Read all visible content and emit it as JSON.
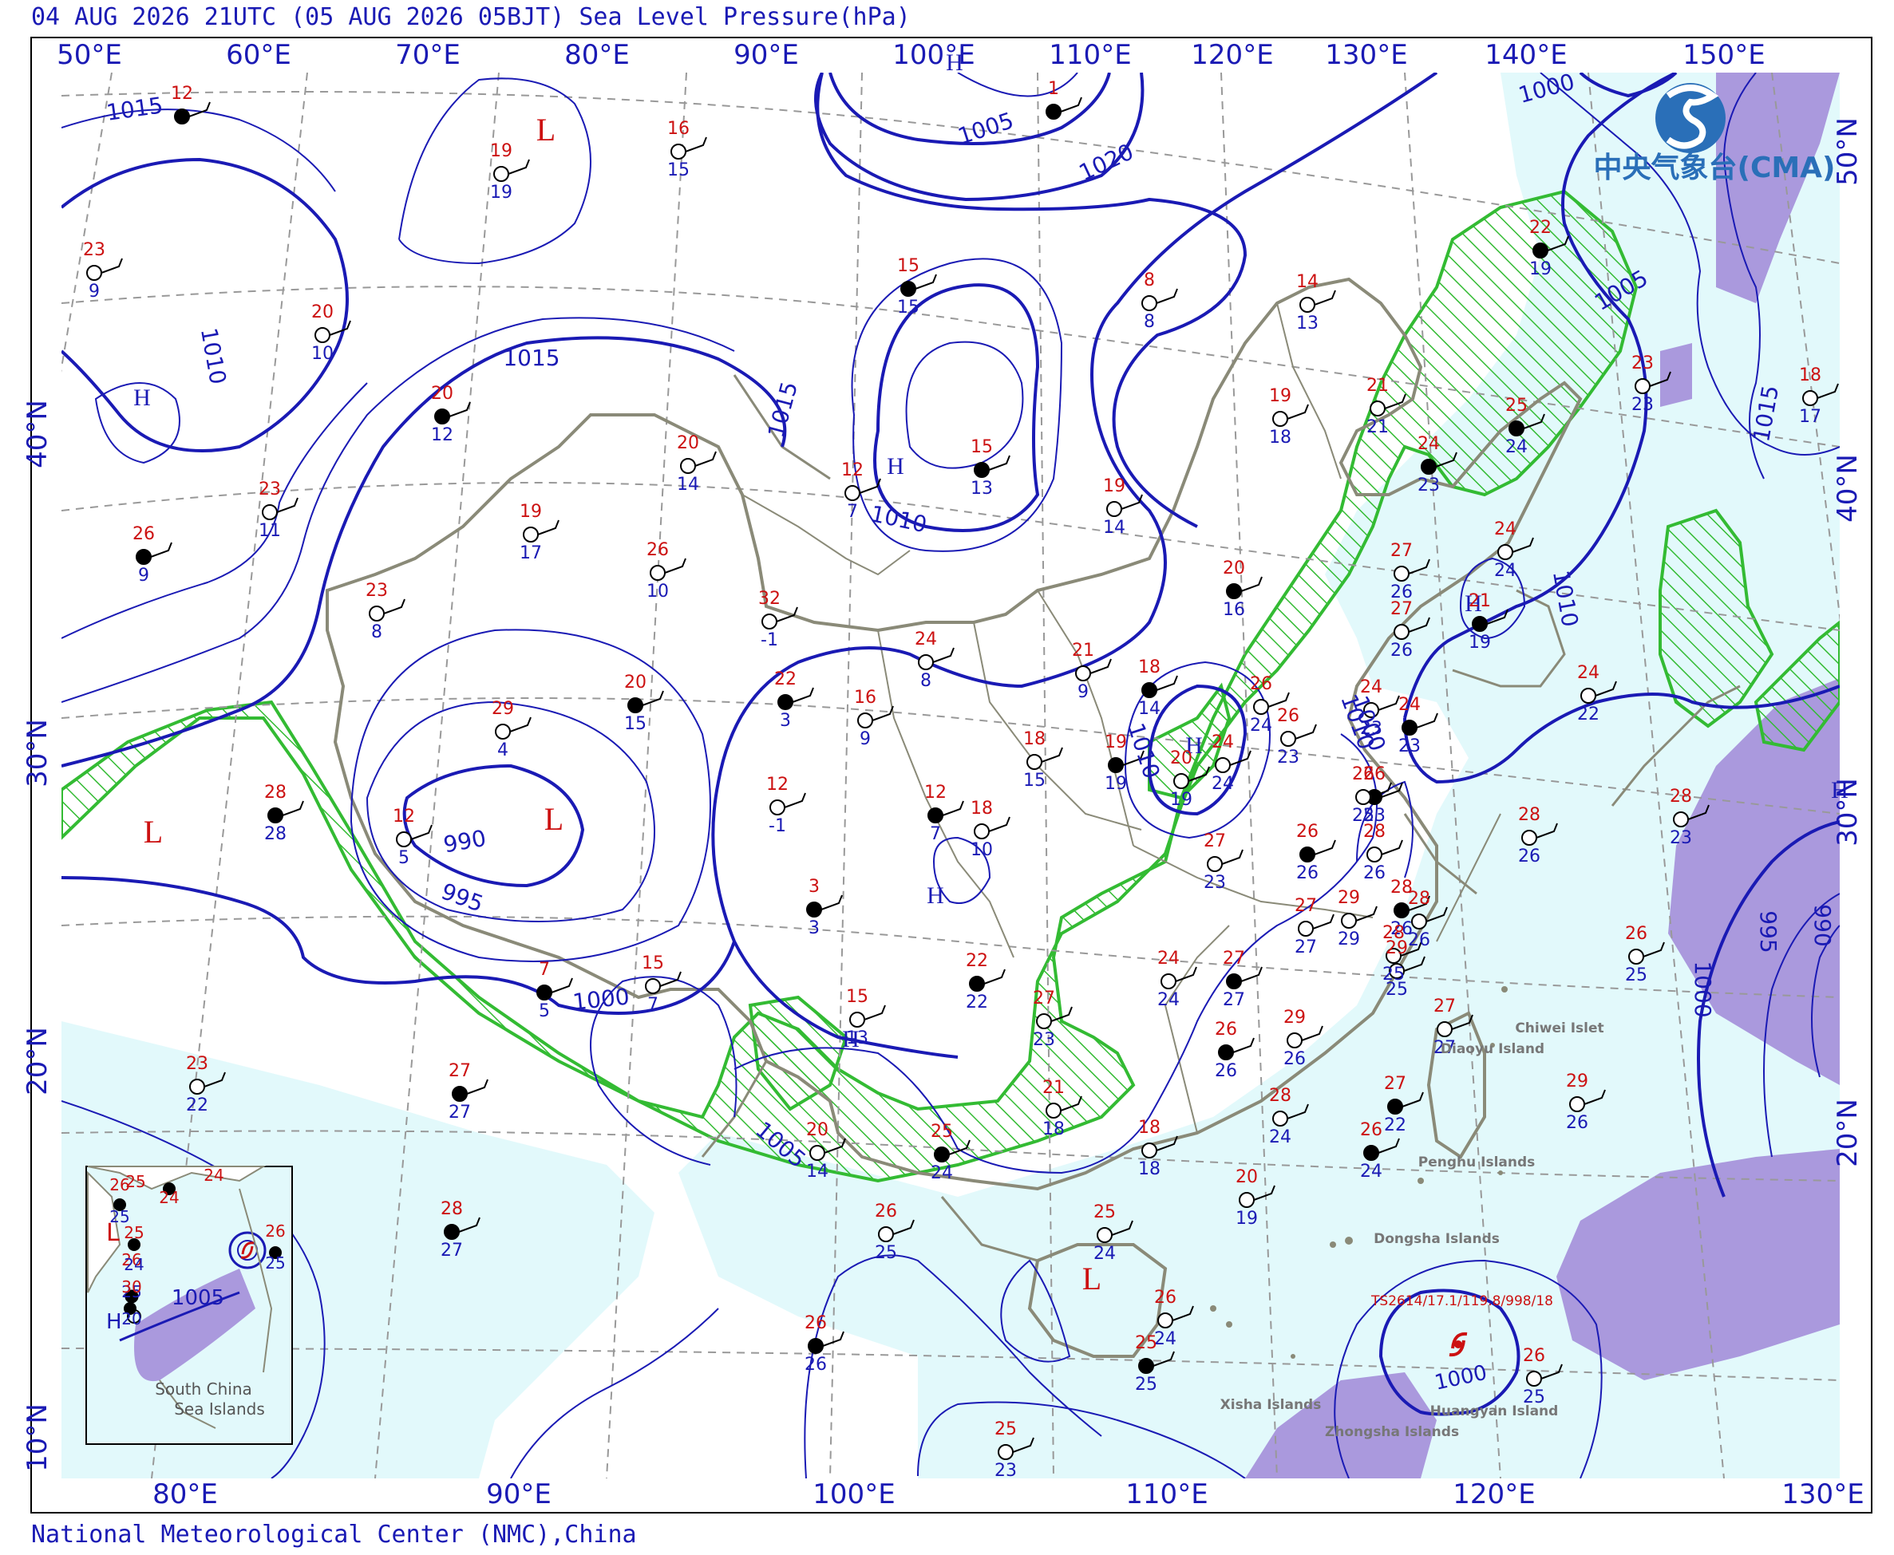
{
  "header": {
    "title": "04 AUG 2026 21UTC (05 AUG 2026 05BJT) Sea Level Pressure(hPa)"
  },
  "footer": {
    "credit": "National Meteorological Center (NMC),China"
  },
  "logo": {
    "text": "中央气象台(CMA)"
  },
  "axes": {
    "top_lon": [
      "50°E",
      "60°E",
      "70°E",
      "80°E",
      "90°E",
      "100°E",
      "110°E",
      "120°E",
      "130°E",
      "140°E",
      "150°E"
    ],
    "bottom_lon": [
      "80°E",
      "90°E",
      "100°E",
      "110°E",
      "120°E",
      "130°E"
    ],
    "left_lat": [
      "40°N",
      "30°N",
      "20°N",
      "10°N"
    ],
    "right_lat": [
      "50°N",
      "40°N",
      "30°N",
      "20°N"
    ]
  },
  "centers": [
    {
      "label": "L",
      "color": "#cc1111"
    },
    {
      "label": "L",
      "color": "#cc1111"
    },
    {
      "label": "L",
      "color": "#cc1111"
    },
    {
      "label": "L",
      "color": "#cc1111"
    },
    {
      "label": "H",
      "color": "#1a1ab4"
    },
    {
      "label": "H",
      "color": "#1a1ab4"
    },
    {
      "label": "H",
      "color": "#1a1ab4"
    },
    {
      "label": "H",
      "color": "#1a1ab4"
    },
    {
      "label": "H",
      "color": "#1a1ab4"
    },
    {
      "label": "H",
      "color": "#1a1ab4"
    },
    {
      "label": "H",
      "color": "#1a1ab4"
    },
    {
      "label": "H",
      "color": "#1a1ab4"
    }
  ],
  "isobar_labels": [
    "1015",
    "1010",
    "1005",
    "1020",
    "1015",
    "1010",
    "1015",
    "990",
    "995",
    "1000",
    "1005",
    "1010",
    "1010",
    "1005",
    "1010",
    "1015",
    "1000",
    "1000",
    "995",
    "990",
    "1000",
    "1005"
  ],
  "stations": [
    {
      "t": "12",
      "d": ""
    },
    {
      "t": "19",
      "d": "19"
    },
    {
      "t": "16",
      "d": "15"
    },
    {
      "t": "1",
      "d": ""
    },
    {
      "t": "23",
      "d": "9"
    },
    {
      "t": "20",
      "d": "10"
    },
    {
      "t": "15",
      "d": "15"
    },
    {
      "t": "8",
      "d": "8"
    },
    {
      "t": "14",
      "d": "13"
    },
    {
      "t": "20",
      "d": "12"
    },
    {
      "t": "20",
      "d": "14"
    },
    {
      "t": "12",
      "d": "7"
    },
    {
      "t": "15",
      "d": "13"
    },
    {
      "t": "19",
      "d": "18"
    },
    {
      "t": "21",
      "d": "21"
    },
    {
      "t": "25",
      "d": "24"
    },
    {
      "t": "23",
      "d": "23"
    },
    {
      "t": "18",
      "d": "17"
    },
    {
      "t": "22",
      "d": "19"
    },
    {
      "t": "23",
      "d": "11"
    },
    {
      "t": "19",
      "d": "17"
    },
    {
      "t": "26",
      "d": "9"
    },
    {
      "t": "26",
      "d": "10"
    },
    {
      "t": "19",
      "d": "14"
    },
    {
      "t": "24",
      "d": "23"
    },
    {
      "t": "32",
      "d": "-1"
    },
    {
      "t": "23",
      "d": "8"
    },
    {
      "t": "21",
      "d": "19"
    },
    {
      "t": "27",
      "d": "26"
    },
    {
      "t": "24",
      "d": "24"
    },
    {
      "t": "20",
      "d": "16"
    },
    {
      "t": "27",
      "d": "26"
    },
    {
      "t": "29",
      "d": "4"
    },
    {
      "t": "20",
      "d": "15"
    },
    {
      "t": "24",
      "d": "8"
    },
    {
      "t": "21",
      "d": "9"
    },
    {
      "t": "18",
      "d": "14"
    },
    {
      "t": "26",
      "d": "24"
    },
    {
      "t": "26",
      "d": "23"
    },
    {
      "t": "24",
      "d": "23"
    },
    {
      "t": "24",
      "d": "22"
    },
    {
      "t": "24",
      "d": "23"
    },
    {
      "t": "22",
      "d": "3"
    },
    {
      "t": "16",
      "d": "9"
    },
    {
      "t": "18",
      "d": "15"
    },
    {
      "t": "19",
      "d": "19"
    },
    {
      "t": "20",
      "d": "19"
    },
    {
      "t": "24",
      "d": "24"
    },
    {
      "t": "26",
      "d": "23"
    },
    {
      "t": "26",
      "d": "25"
    },
    {
      "t": "28",
      "d": "23"
    },
    {
      "t": "28",
      "d": "28"
    },
    {
      "t": "12",
      "d": "5"
    },
    {
      "t": "12",
      "d": "-1"
    },
    {
      "t": "12",
      "d": "7"
    },
    {
      "t": "18",
      "d": "10"
    },
    {
      "t": "27",
      "d": "23"
    },
    {
      "t": "26",
      "d": "26"
    },
    {
      "t": "28",
      "d": "26"
    },
    {
      "t": "28",
      "d": "26"
    },
    {
      "t": "3",
      "d": "3"
    },
    {
      "t": "27",
      "d": "27"
    },
    {
      "t": "29",
      "d": "29"
    },
    {
      "t": "28",
      "d": "26"
    },
    {
      "t": "28",
      "d": "25"
    },
    {
      "t": "28",
      "d": "26"
    },
    {
      "t": "7",
      "d": "5"
    },
    {
      "t": "15",
      "d": "7"
    },
    {
      "t": "15",
      "d": "13"
    },
    {
      "t": "22",
      "d": "22"
    },
    {
      "t": "27",
      "d": "23"
    },
    {
      "t": "24",
      "d": "24"
    },
    {
      "t": "27",
      "d": "27"
    },
    {
      "t": "29",
      "d": "25"
    },
    {
      "t": "27",
      "d": "27"
    },
    {
      "t": "26",
      "d": "26"
    },
    {
      "t": "29",
      "d": "26"
    },
    {
      "t": "23",
      "d": "22"
    },
    {
      "t": "27",
      "d": "27"
    },
    {
      "t": "21",
      "d": "18"
    },
    {
      "t": "28",
      "d": "24"
    },
    {
      "t": "27",
      "d": "22"
    },
    {
      "t": "29",
      "d": "26"
    },
    {
      "t": "26",
      "d": "25"
    },
    {
      "t": "26",
      "d": "24"
    },
    {
      "t": "18",
      "d": "18"
    },
    {
      "t": "20",
      "d": "14"
    },
    {
      "t": "25",
      "d": "24"
    },
    {
      "t": "20",
      "d": "19"
    },
    {
      "t": "26",
      "d": "25"
    },
    {
      "t": "28",
      "d": "27"
    },
    {
      "t": "25",
      "d": "24"
    },
    {
      "t": "26",
      "d": "24"
    },
    {
      "t": "25",
      "d": "25"
    },
    {
      "t": "26",
      "d": "25"
    },
    {
      "t": "25",
      "d": "23"
    },
    {
      "t": "26",
      "d": "26"
    }
  ],
  "place_labels": [
    "Chiwei Islet",
    "Diaoyu Island",
    "Penghu Islands",
    "Dongsha Islands",
    "Xisha Islands",
    "Huangyan Island",
    "Zhongsha Islands"
  ],
  "typhoon": {
    "label": "TS2614/17.1/119.8/998/18",
    "isobar": "1000"
  },
  "inset": {
    "label_line1": "South China",
    "label_line2": "Sea Islands",
    "isobar": "1005",
    "center_h": "H",
    "center_l": "L",
    "stations": [
      {
        "t": "26",
        "d": "25"
      },
      {
        "t": "25",
        "d": ""
      },
      {
        "t": "24",
        "d": ""
      },
      {
        "t": "24",
        "d": ""
      },
      {
        "t": "26",
        "d": "25"
      },
      {
        "t": "25",
        "d": "24"
      },
      {
        "t": "26",
        "d": "25"
      },
      {
        "t": "30",
        "d": "20"
      }
    ]
  },
  "colors": {
    "isobar": "#1a1ab4",
    "temperature": "#cc1111",
    "dewpoint": "#1a1ab4",
    "sea": "#e2f9fb",
    "rain_area": "#33bb33",
    "heavy_rain": "#aa99dd",
    "border": "#888877",
    "grid": "#999999"
  }
}
